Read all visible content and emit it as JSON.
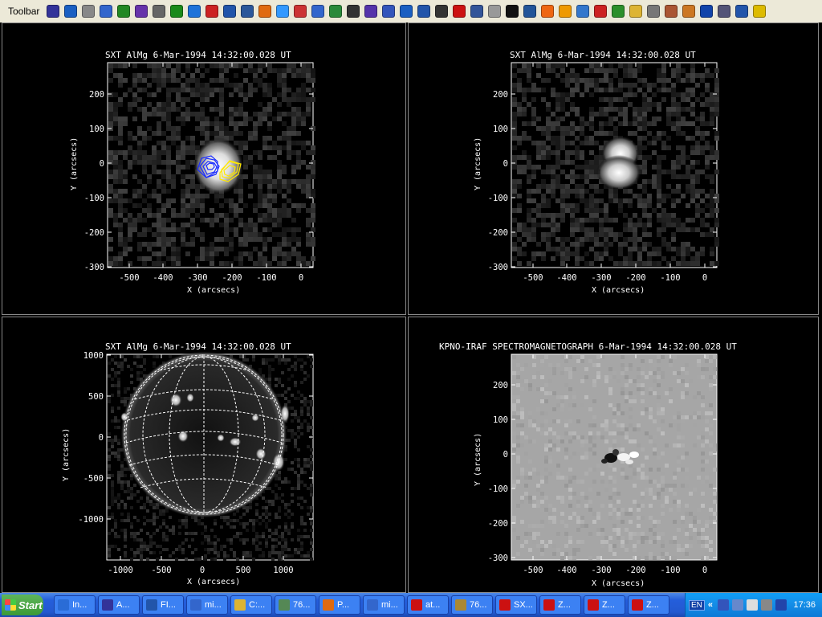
{
  "toolbar": {
    "label": "Toolbar",
    "icons": [
      "app-a-icon",
      "globe-icon",
      "photo-icon",
      "document-icon",
      "music-icon",
      "seal-icon",
      "chat-icon",
      "clover-icon",
      "ie-icon",
      "stop-icon",
      "help-icon",
      "word-icon",
      "firefox-icon",
      "balloon-icon",
      "cd-icon",
      "link-icon",
      "refresh-icon",
      "calendar-icon",
      "wand-icon",
      "grid-icon",
      "window-icon",
      "network-icon",
      "cancel-icon",
      "record-icon",
      "display-icon",
      "note-icon",
      "close-x-icon",
      "tools-icon",
      "mail-icon",
      "sun-icon",
      "globe2-icon",
      "red-page-icon",
      "image-icon",
      "folder-icon",
      "brush-icon",
      "paint-icon",
      "clock-icon",
      "media-icon",
      "disc-icon",
      "window2-icon",
      "warning-icon"
    ],
    "colors": [
      "#333399",
      "#1a5fc2",
      "#888888",
      "#3366cc",
      "#228822",
      "#6633aa",
      "#666666",
      "#1a8a1a",
      "#1e73d9",
      "#cc2222",
      "#2255aa",
      "#2b579a",
      "#e06a10",
      "#3399ff",
      "#cc3333",
      "#3366cc",
      "#2a8a3a",
      "#333333",
      "#5533aa",
      "#3355bb",
      "#1a5fc2",
      "#2255aa",
      "#333333",
      "#cc1111",
      "#335599",
      "#999999",
      "#111111",
      "#225599",
      "#ee6611",
      "#ee9900",
      "#3377cc",
      "#cc2222",
      "#2b8f2b",
      "#ddb433",
      "#777777",
      "#aa5533",
      "#cc7722",
      "#1144aa",
      "#555577",
      "#2255aa",
      "#ddbb00"
    ]
  },
  "panels": {
    "tl": {
      "title": "SXT AlMg   6-Mar-1994 14:32:00.028 UT",
      "xlabel": "X (arcsecs)",
      "ylabel": "Y (arcsecs)",
      "xticks": [
        "-500",
        "-400",
        "-300",
        "-200",
        "-100",
        "0"
      ],
      "yticks": [
        "200",
        "100",
        "0",
        "-100",
        "-200",
        "-300"
      ]
    },
    "tr": {
      "title": "SXT AlMg   6-Mar-1994 14:32:00.028 UT",
      "xlabel": "X (arcsecs)",
      "ylabel": "Y (arcsecs)",
      "xticks": [
        "-500",
        "-400",
        "-300",
        "-200",
        "-100",
        "0"
      ],
      "yticks": [
        "200",
        "100",
        "0",
        "-100",
        "-200",
        "-300"
      ]
    },
    "bl": {
      "title": "SXT AlMg   6-Mar-1994 14:32:00.028 UT",
      "xlabel": "X (arcsecs)",
      "ylabel": "Y (arcsecs)",
      "xticks": [
        "-1000",
        "-500",
        "0",
        "500",
        "1000"
      ],
      "yticks": [
        "1000",
        "500",
        "0",
        "-500",
        "-1000"
      ]
    },
    "br": {
      "title": "KPNO-IRAF SPECTROMAGNETOGRAPH   6-Mar-1994 14:32:00.028 UT",
      "xlabel": "X (arcsecs)",
      "ylabel": "Y (arcsecs)",
      "xticks": [
        "-500",
        "-400",
        "-300",
        "-200",
        "-100",
        "0"
      ],
      "yticks": [
        "200",
        "100",
        "0",
        "-100",
        "-200",
        "-300"
      ]
    }
  },
  "taskbar": {
    "start": "Start",
    "tasks": [
      {
        "label": "In...",
        "color": "#2a6cd6"
      },
      {
        "label": "A...",
        "color": "#333399"
      },
      {
        "label": "FI...",
        "color": "#2255aa"
      },
      {
        "label": "mi...",
        "color": "#3366cc"
      },
      {
        "label": "C:...",
        "color": "#ddb433"
      },
      {
        "label": "76...",
        "color": "#558855"
      },
      {
        "label": "P...",
        "color": "#e06a10"
      },
      {
        "label": "mi...",
        "color": "#3366cc"
      },
      {
        "label": "at...",
        "color": "#cc1111"
      },
      {
        "label": "76...",
        "color": "#aa8833"
      },
      {
        "label": "SX...",
        "color": "#cc1111"
      },
      {
        "label": "Z...",
        "color": "#cc1111"
      },
      {
        "label": "Z...",
        "color": "#cc1111"
      },
      {
        "label": "Z...",
        "color": "#cc1111"
      }
    ],
    "tray": {
      "lang": "EN",
      "chevron": "«",
      "clock": "17:36",
      "icons": [
        "network-icon",
        "screen-icon",
        "chat-bubble-icon",
        "volume-icon",
        "v-shield-icon"
      ]
    }
  }
}
